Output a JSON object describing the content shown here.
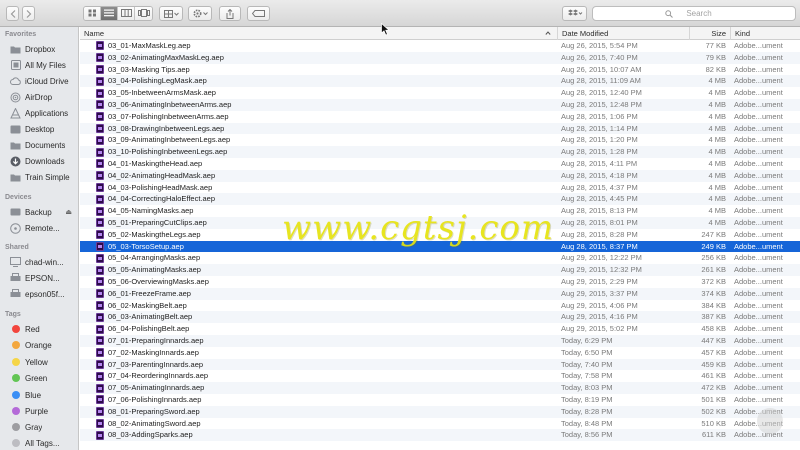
{
  "window": {
    "back_icon": "chevron-left-icon",
    "forward_icon": "chevron-right-icon"
  },
  "toolbar": {
    "view_modes": [
      "icon-view",
      "list-view",
      "column-view",
      "cover-flow-view"
    ],
    "active_view": "list-view",
    "arrange_icon": "grid-icon",
    "action_icon": "gear-icon",
    "share_icon": "share-icon",
    "tag_icon": "tag-icon",
    "dropbox_icon": "dropbox-icon",
    "search_placeholder": "Search"
  },
  "sidebar": {
    "favorites_title": "Favorites",
    "favorites": [
      {
        "label": "Dropbox",
        "icon": "folder-icon"
      },
      {
        "label": "All My Files",
        "icon": "all-files-icon"
      },
      {
        "label": "iCloud Drive",
        "icon": "cloud-icon"
      },
      {
        "label": "AirDrop",
        "icon": "airdrop-icon"
      },
      {
        "label": "Applications",
        "icon": "applications-icon"
      },
      {
        "label": "Desktop",
        "icon": "desktop-icon"
      },
      {
        "label": "Documents",
        "icon": "documents-icon"
      },
      {
        "label": "Downloads",
        "icon": "downloads-icon"
      },
      {
        "label": "Train Simple",
        "icon": "folder-icon"
      }
    ],
    "devices_title": "Devices",
    "devices": [
      {
        "label": "Backup",
        "icon": "drive-icon"
      },
      {
        "label": "Remote...",
        "icon": "disc-icon"
      }
    ],
    "shared_title": "Shared",
    "shared": [
      {
        "label": "chad-win...",
        "icon": "computer-icon"
      },
      {
        "label": "EPSON...",
        "icon": "printer-icon"
      },
      {
        "label": "epson05f...",
        "icon": "printer-icon"
      }
    ],
    "tags_title": "Tags",
    "tags": [
      {
        "label": "Red",
        "color": "#f2453d"
      },
      {
        "label": "Orange",
        "color": "#f3a73f"
      },
      {
        "label": "Yellow",
        "color": "#f5d547"
      },
      {
        "label": "Green",
        "color": "#62c554"
      },
      {
        "label": "Blue",
        "color": "#3b8ff5"
      },
      {
        "label": "Purple",
        "color": "#b46ad8"
      },
      {
        "label": "Gray",
        "color": "#9d9da1"
      },
      {
        "label": "All Tags...",
        "color": "#bdbdc2"
      }
    ]
  },
  "list": {
    "columns": {
      "name": "Name",
      "date": "Date Modified",
      "size": "Size",
      "kind": "Kind"
    },
    "selected_index": 15,
    "rows": [
      {
        "name": "03_01-MaxMaskLeg.aep",
        "date": "Aug 26, 2015, 5:54 PM",
        "size": "77 KB",
        "kind": "Adobe...ument"
      },
      {
        "name": "03_02-AnimatingMaxMaskLeg.aep",
        "date": "Aug 26, 2015, 7:40 PM",
        "size": "79 KB",
        "kind": "Adobe...ument"
      },
      {
        "name": "03_03-Masking Tips.aep",
        "date": "Aug 26, 2015, 10:07 AM",
        "size": "82 KB",
        "kind": "Adobe...ument"
      },
      {
        "name": "03_04-PolishingLegMask.aep",
        "date": "Aug 28, 2015, 11:09 AM",
        "size": "4 MB",
        "kind": "Adobe...ument"
      },
      {
        "name": "03_05-InbetweenArmsMask.aep",
        "date": "Aug 28, 2015, 12:40 PM",
        "size": "4 MB",
        "kind": "Adobe...ument"
      },
      {
        "name": "03_06-AnimatingInbetweenArms.aep",
        "date": "Aug 28, 2015, 12:48 PM",
        "size": "4 MB",
        "kind": "Adobe...ument"
      },
      {
        "name": "03_07-PolishingInbetweenArms.aep",
        "date": "Aug 28, 2015, 1:06 PM",
        "size": "4 MB",
        "kind": "Adobe...ument"
      },
      {
        "name": "03_08-DrawingInbetweenLegs.aep",
        "date": "Aug 28, 2015, 1:14 PM",
        "size": "4 MB",
        "kind": "Adobe...ument"
      },
      {
        "name": "03_09-AnimatingInbetweenLegs.aep",
        "date": "Aug 28, 2015, 1:20 PM",
        "size": "4 MB",
        "kind": "Adobe...ument"
      },
      {
        "name": "03_10-PolishingInbetweenLegs.aep",
        "date": "Aug 28, 2015, 1:28 PM",
        "size": "4 MB",
        "kind": "Adobe...ument"
      },
      {
        "name": "04_01-MaskingtheHead.aep",
        "date": "Aug 28, 2015, 4:11 PM",
        "size": "4 MB",
        "kind": "Adobe...ument"
      },
      {
        "name": "04_02-AnimatingHeadMask.aep",
        "date": "Aug 28, 2015, 4:18 PM",
        "size": "4 MB",
        "kind": "Adobe...ument"
      },
      {
        "name": "04_03-PolishingHeadMask.aep",
        "date": "Aug 28, 2015, 4:37 PM",
        "size": "4 MB",
        "kind": "Adobe...ument"
      },
      {
        "name": "04_04-CorrectingHaloEffect.aep",
        "date": "Aug 28, 2015, 4:45 PM",
        "size": "4 MB",
        "kind": "Adobe...ument"
      },
      {
        "name": "04_05-NamingMasks.aep",
        "date": "Aug 28, 2015, 8:13 PM",
        "size": "4 MB",
        "kind": "Adobe...ument"
      },
      {
        "name": "05_01-PreparingCutClips.aep",
        "date": "Aug 28, 2015, 8:01 PM",
        "size": "4 MB",
        "kind": "Adobe...ument"
      },
      {
        "name": "05_02-MaskingtheLegs.aep",
        "date": "Aug 28, 2015, 8:28 PM",
        "size": "247 KB",
        "kind": "Adobe...ument"
      },
      {
        "name": "05_03-TorsoSetup.aep",
        "date": "Aug 28, 2015, 8:37 PM",
        "size": "249 KB",
        "kind": "Adobe...ument"
      },
      {
        "name": "05_04-ArrangingMasks.aep",
        "date": "Aug 29, 2015, 12:22 PM",
        "size": "256 KB",
        "kind": "Adobe...ument"
      },
      {
        "name": "05_05-AnimatingMasks.aep",
        "date": "Aug 29, 2015, 12:32 PM",
        "size": "261 KB",
        "kind": "Adobe...ument"
      },
      {
        "name": "05_06-OverviewingMasks.aep",
        "date": "Aug 29, 2015, 2:29 PM",
        "size": "372 KB",
        "kind": "Adobe...ument"
      },
      {
        "name": "06_01-FreezeFrame.aep",
        "date": "Aug 29, 2015, 3:37 PM",
        "size": "374 KB",
        "kind": "Adobe...ument"
      },
      {
        "name": "06_02-MaskingBelt.aep",
        "date": "Aug 29, 2015, 4:06 PM",
        "size": "384 KB",
        "kind": "Adobe...ument"
      },
      {
        "name": "06_03-AnimatingBelt.aep",
        "date": "Aug 29, 2015, 4:16 PM",
        "size": "387 KB",
        "kind": "Adobe...ument"
      },
      {
        "name": "06_04-PolishingBelt.aep",
        "date": "Aug 29, 2015, 5:02 PM",
        "size": "458 KB",
        "kind": "Adobe...ument"
      },
      {
        "name": "07_01-PreparingInnards.aep",
        "date": "Today, 6:29 PM",
        "size": "447 KB",
        "kind": "Adobe...ument"
      },
      {
        "name": "07_02-MaskingInnards.aep",
        "date": "Today, 6:50 PM",
        "size": "457 KB",
        "kind": "Adobe...ument"
      },
      {
        "name": "07_03-ParentingInnards.aep",
        "date": "Today, 7:40 PM",
        "size": "459 KB",
        "kind": "Adobe...ument"
      },
      {
        "name": "07_04-ReorderingInnards.aep",
        "date": "Today, 7:58 PM",
        "size": "461 KB",
        "kind": "Adobe...ument"
      },
      {
        "name": "07_05-AnimatingInnards.aep",
        "date": "Today, 8:03 PM",
        "size": "472 KB",
        "kind": "Adobe...ument"
      },
      {
        "name": "07_06-PolishingInnards.aep",
        "date": "Today, 8:19 PM",
        "size": "501 KB",
        "kind": "Adobe...ument"
      },
      {
        "name": "08_01-PreparingSword.aep",
        "date": "Today, 8:28 PM",
        "size": "502 KB",
        "kind": "Adobe...ument"
      },
      {
        "name": "08_02-AnimatingSword.aep",
        "date": "Today, 8:48 PM",
        "size": "510 KB",
        "kind": "Adobe...ument"
      },
      {
        "name": "08_03-AddingSparks.aep",
        "date": "Today, 8:56 PM",
        "size": "611 KB",
        "kind": "Adobe...ument"
      }
    ]
  },
  "watermark": "www.cgtsj.com"
}
